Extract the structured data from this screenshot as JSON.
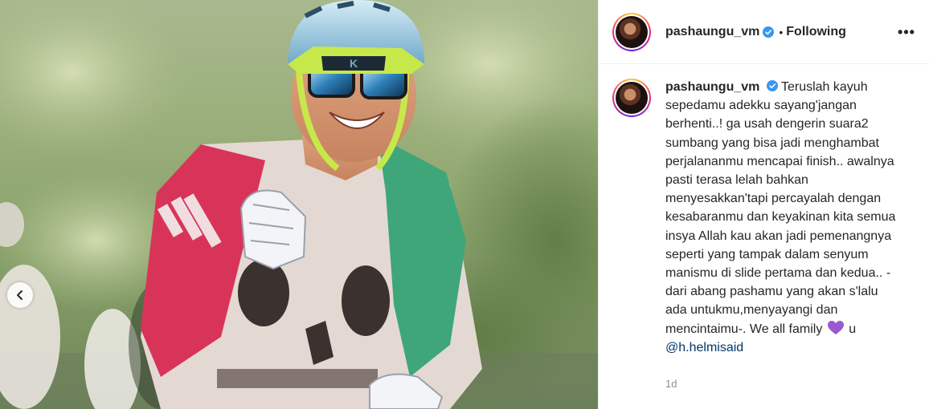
{
  "post": {
    "username": "pashaungu_vm",
    "follow_status": "Following",
    "separator": "•",
    "more_label": "•••"
  },
  "caption": {
    "username": "pashaungu_vm",
    "text": "Teruslah kayuh sepedamu adekku sayang'jangan berhenti..! ga usah dengerin suara2 sumbang yang bisa jadi menghambat perjalananmu mencapai finish.. awalnya pasti terasa lelah bahkan menyesakkan'tapi percayalah dengan kesabaranmu dan keyakinan kita semua insya Allah kau akan jadi pemenangnya seperti yang tampak dalam senyum manismu di slide pertama dan kedua.. -dari abang pashamu yang akan s'lalu ada untukmu,menyayangi dan mencintaimu-. We all family",
    "after_heart": "u",
    "mention": "@h.helmisaid",
    "timestamp": "1d"
  },
  "colors": {
    "accent_verified": "#3897f0",
    "heart": "#9b59d0",
    "mention": "#00376b"
  },
  "icons": {
    "verified": "verified-badge-icon",
    "heart": "purple-heart-icon",
    "prev": "chevron-left-icon"
  }
}
